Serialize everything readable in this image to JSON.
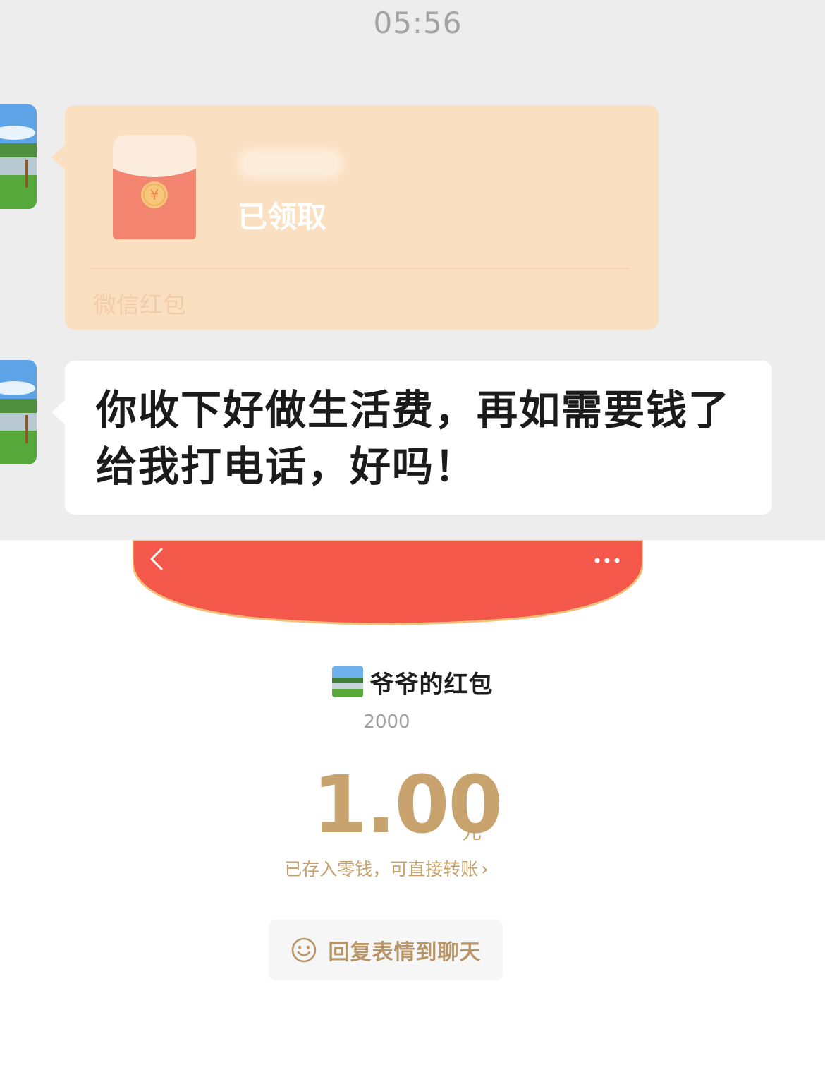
{
  "chat": {
    "time": "05:56",
    "red_packet": {
      "status": "已领取",
      "footer": "微信红包"
    },
    "message": {
      "text": "你收下好做生活费，再如需要钱了给我打电话，好吗！"
    }
  },
  "detail": {
    "sender_title": "爷爷的红包",
    "wish": "2000",
    "amount": "1.00",
    "unit": "元",
    "deposit_note": "已存入零钱，可直接转账",
    "reply_button": "回复表情到聊天"
  },
  "colors": {
    "chat_bg": "#ededed",
    "packet_bubble": "#fadfc1",
    "header_red": "#f4584a",
    "gold": "#c8a36e"
  },
  "icons": [
    "back-icon",
    "more-icon",
    "smiley-icon",
    "yuan-icon"
  ]
}
